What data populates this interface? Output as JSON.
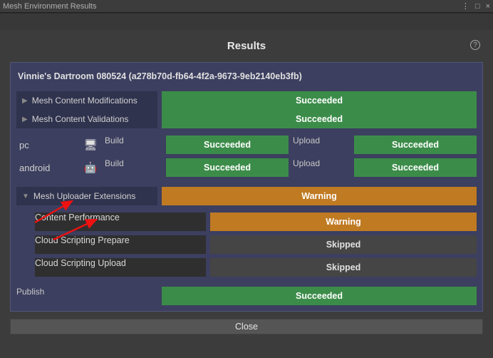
{
  "window": {
    "title": "Mesh Environment Results"
  },
  "header": {
    "title": "Results"
  },
  "environment": {
    "title": "Vinnie's Dartroom 080524 (a278b70d-fb64-4f2a-9673-9eb2140eb3fb)"
  },
  "top_rows": [
    {
      "label": "Mesh Content Modifications",
      "status": "Succeeded",
      "status_kind": "succeeded"
    },
    {
      "label": "Mesh Content Validations",
      "status": "Succeeded",
      "status_kind": "succeeded"
    }
  ],
  "platforms": [
    {
      "name": "pc",
      "icon": "monitor",
      "build": {
        "label": "Build",
        "status": "Succeeded",
        "status_kind": "succeeded"
      },
      "upload": {
        "label": "Upload",
        "status": "Succeeded",
        "status_kind": "succeeded"
      }
    },
    {
      "name": "android",
      "icon": "android",
      "build": {
        "label": "Build",
        "status": "Succeeded",
        "status_kind": "succeeded"
      },
      "upload": {
        "label": "Upload",
        "status": "Succeeded",
        "status_kind": "succeeded"
      }
    }
  ],
  "uploader_section": {
    "label": "Mesh Uploader Extensions",
    "status": "Warning",
    "status_kind": "warning"
  },
  "sub_rows": [
    {
      "label": "Content Performance",
      "status": "Warning",
      "status_kind": "warning"
    },
    {
      "label": "Cloud Scripting Prepare",
      "status": "Skipped",
      "status_kind": "skipped"
    },
    {
      "label": "Cloud Scripting Upload",
      "status": "Skipped",
      "status_kind": "skipped"
    }
  ],
  "publish": {
    "label": "Publish",
    "status": "Succeeded",
    "status_kind": "succeeded"
  },
  "footer": {
    "close": "Close"
  },
  "icons": {
    "monitor": "🖥",
    "android": "🤖"
  },
  "colors": {
    "succeeded": "#3c8c49",
    "warning": "#c07a22",
    "skipped": "#454545",
    "panel_bg": "#3c3f5f",
    "panel_border": "#525678"
  }
}
